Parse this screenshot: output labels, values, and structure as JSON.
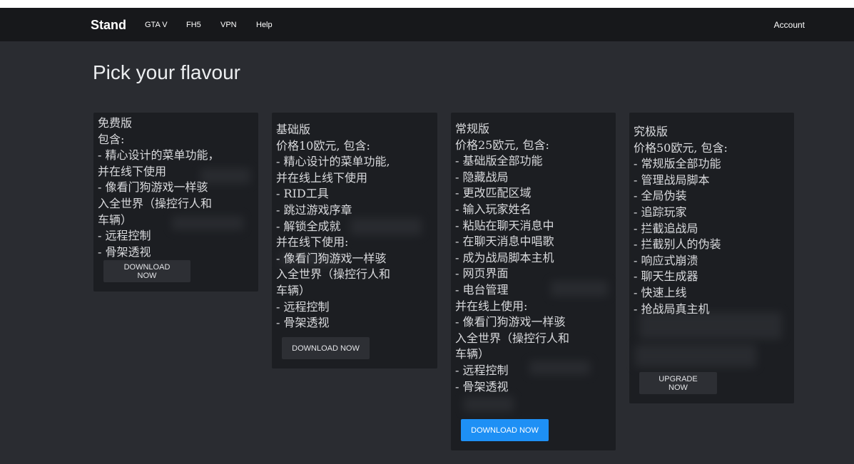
{
  "nav": {
    "brand": "Stand",
    "links": [
      "GTA V",
      "FH5",
      "VPN",
      "Help"
    ],
    "account": "Account"
  },
  "page": {
    "title": "Pick your flavour"
  },
  "plans": [
    {
      "body": "免费版\n包含:\n- 精心设计的菜单功能，\n并在线下使用\n- 像看门狗游戏一样骇\n入全世界（操控行人和\n车辆）\n- 远程控制\n- 骨架透视",
      "button": "DOWNLOAD NOW"
    },
    {
      "body": "基础版\n价格10欧元, 包含:\n- 精心设计的菜单功能,\n并在线上线下使用\n- RID工具\n- 跳过游戏序章\n- 解锁全成就\n并在线下使用:\n- 像看门狗游戏一样骇\n入全世界（操控行人和\n车辆）\n- 远程控制\n- 骨架透视",
      "button": "DOWNLOAD NOW"
    },
    {
      "body": "常规版\n价格25欧元, 包含:\n- 基础版全部功能\n- 隐藏战局\n- 更改匹配区域\n- 输入玩家姓名\n- 粘贴在聊天消息中\n- 在聊天消息中唱歌\n- 成为战局脚本主机\n- 网页界面\n- 电台管理\n并在线上使用:\n- 像看门狗游戏一样骇\n入全世界（操控行人和\n车辆）\n- 远程控制\n- 骨架透视",
      "button": "DOWNLOAD NOW"
    },
    {
      "body": "究极版\n价格50欧元, 包含:\n- 常规版全部功能\n- 管理战局脚本\n- 全局伪装\n- 追踪玩家\n- 拦截追战局\n- 拦截别人的伪装\n- 响应式崩溃\n- 聊天生成器\n- 快速上线\n- 抢战局真主机",
      "button": "UPGRADE NOW"
    }
  ],
  "colors": {
    "background": "#2a2c31",
    "navbar": "#17181b",
    "card": "#1c1e22",
    "button": "#2d2f34",
    "primary_button": "#1e90f5"
  }
}
